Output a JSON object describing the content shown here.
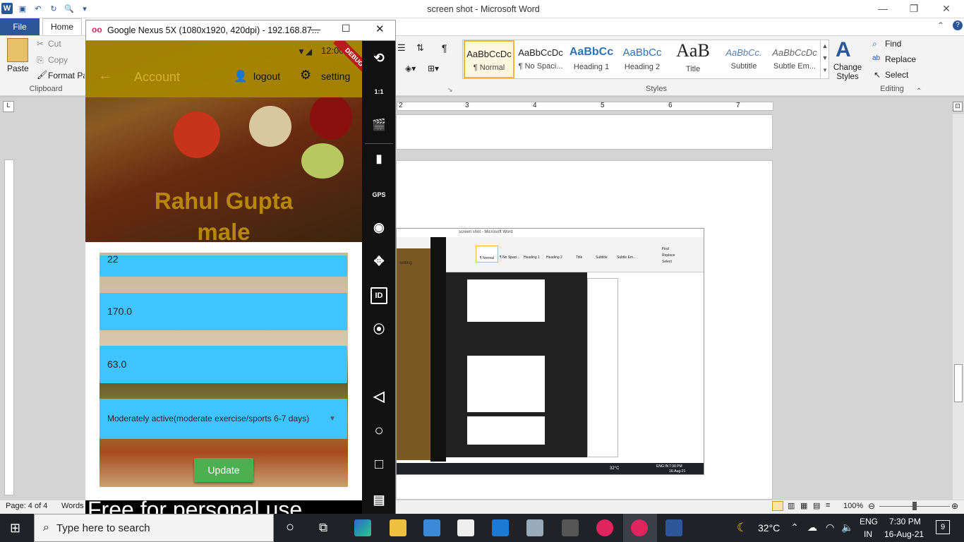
{
  "word": {
    "window_title": "screen shot  -  Microsoft Word",
    "tabs": {
      "file": "File",
      "home": "Home"
    },
    "clipboard": {
      "paste": "Paste",
      "cut": "Cut",
      "copy": "Copy",
      "format_painter": "Format Pai",
      "group": "Clipboard"
    },
    "styles": [
      {
        "sample": "AaBbCcDc",
        "name": "¶ Normal"
      },
      {
        "sample": "AaBbCcDc",
        "name": "¶ No Spaci..."
      },
      {
        "sample": "AaBbCc",
        "name": "Heading 1"
      },
      {
        "sample": "AaBbCc",
        "name": "Heading 2"
      },
      {
        "sample": "AaB",
        "name": "Title"
      },
      {
        "sample": "AaBbCc.",
        "name": "Subtitle"
      },
      {
        "sample": "AaBbCcDc",
        "name": "Subtle Em..."
      }
    ],
    "styles_group": "Styles",
    "change_styles": "Change Styles",
    "editing": {
      "find": "Find",
      "replace": "Replace",
      "select": "Select",
      "group": "Editing"
    },
    "ruler_numbers": [
      "2",
      "3",
      "4",
      "5",
      "6",
      "7"
    ],
    "status": {
      "page": "Page: 4 of 4",
      "words": "Words",
      "zoom": "100%"
    }
  },
  "emulator": {
    "title": "Google Nexus 5X (1080x1920, 420dpi) - 192.168.87...",
    "status_time": "12:00",
    "debug_banner": "DEBUG",
    "appbar": {
      "title": "Account",
      "logout": "logout",
      "setting": "setting"
    },
    "profile": {
      "name": "Rahul Gupta",
      "gender": "male"
    },
    "fields": {
      "age": "22",
      "height": "170.0",
      "weight": "63.0"
    },
    "activity": "Moderately active(moderate exercise/sports 6-7 days)",
    "update_button": "Update",
    "watermark": "Free for personal use",
    "side_labels": {
      "scale": "1:1",
      "gps": "GPS",
      "id": "ID"
    }
  },
  "nested": {
    "title": "screen shot - Microsoft Word",
    "setting": "setting",
    "styles": [
      "¶ Normal",
      "¶ No Spaci...",
      "Heading 1",
      "Heading 2",
      "Title",
      "Subtitle",
      "Subtle Em..."
    ],
    "editing": [
      "Find",
      "Replace",
      "Select"
    ],
    "temp": "32°C",
    "lang": "ENG IN",
    "time": "7:30 PM",
    "date": "16-Aug-21"
  },
  "taskbar": {
    "search_placeholder": "Type here to search",
    "temperature": "32°C",
    "lang_top": "ENG",
    "lang_bottom": "IN",
    "time": "7:30 PM",
    "date": "16-Aug-21",
    "notification_count": "9"
  }
}
